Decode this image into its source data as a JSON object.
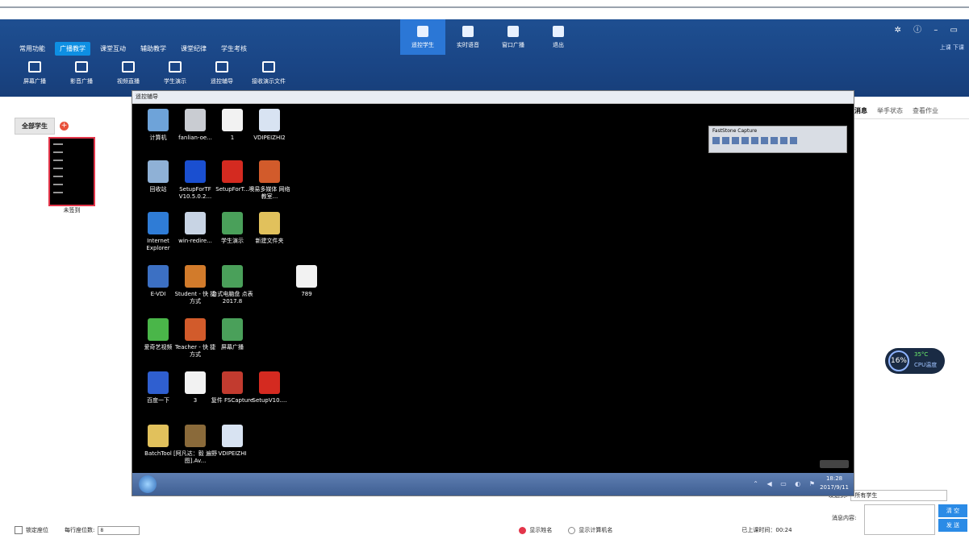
{
  "app": {
    "menu": [
      "常用功能",
      "广播教学",
      "课堂互动",
      "辅助教学",
      "课堂纪律",
      "学生考核"
    ],
    "active_menu": 1,
    "tools": [
      {
        "icon": "screen-broadcast-icon",
        "label": "屏幕广播"
      },
      {
        "icon": "video-broadcast-icon",
        "label": "影音广播"
      },
      {
        "icon": "video-live-icon",
        "label": "视频直播"
      },
      {
        "icon": "student-demo-icon",
        "label": "学生演示"
      },
      {
        "icon": "remote-control-icon",
        "label": "遥控辅导"
      },
      {
        "icon": "file-send-icon",
        "label": "接收演示文件"
      }
    ],
    "top_buttons": [
      {
        "label": "遥控学生",
        "icon": "remote-student-icon",
        "active": true
      },
      {
        "label": "实时语音",
        "icon": "microphone-icon",
        "active": false
      },
      {
        "label": "窗口广播",
        "icon": "window-broadcast-icon",
        "active": false
      },
      {
        "label": "退出",
        "icon": "exit-icon",
        "active": false
      }
    ],
    "window_controls": "✲ ⓘ – ▭",
    "login_links": "上课  下课"
  },
  "left": {
    "tab": "全部学生",
    "student_status": "未签到"
  },
  "right": {
    "tabs": [
      "消息",
      "举手状态",
      "查看作业"
    ],
    "cpu_percent": "16%",
    "cpu_temp": "35°C",
    "cpu_label": "CPU温度",
    "send_to_label": "发送到:",
    "send_to_value": "所有学生",
    "message_label": "消息内容:",
    "clear_btn": "清 空",
    "send_btn": "发 送"
  },
  "status": {
    "lock_seat": "锁定座位",
    "per_row_label": "每行座位数:",
    "per_row_value": "8",
    "show_name": "显示姓名",
    "show_pc": "显示计算机名",
    "elapsed_label": "已上课时间：",
    "elapsed_value": "00:24"
  },
  "remote": {
    "title": "遥控辅导",
    "icons": [
      {
        "label": "计算机",
        "col": 0,
        "row": 0,
        "color": "#6ea3d9"
      },
      {
        "label": "fanlian-oe...",
        "col": 1,
        "row": 0,
        "color": "#c9ccd2"
      },
      {
        "label": "1",
        "col": 2,
        "row": 0,
        "color": "#f2f2f2"
      },
      {
        "label": "VDIPEIZHI2",
        "col": 3,
        "row": 0,
        "color": "#d8e3f2"
      },
      {
        "label": "回收站",
        "col": 0,
        "row": 1,
        "color": "#8fb1d6"
      },
      {
        "label": "SetupForTF V10.5.0.2...",
        "col": 1,
        "row": 1,
        "color": "#1a4fd0"
      },
      {
        "label": "SetupForT...",
        "col": 2,
        "row": 1,
        "color": "#d42a20"
      },
      {
        "label": "噢易多媒体 网络教室...",
        "col": 3,
        "row": 1,
        "color": "#d25b2b"
      },
      {
        "label": "Internet Explorer",
        "col": 0,
        "row": 2,
        "color": "#2f7cd6"
      },
      {
        "label": "win-redire...",
        "col": 1,
        "row": 2,
        "color": "#c8d4e4"
      },
      {
        "label": "学生演示",
        "col": 2,
        "row": 2,
        "color": "#4aa05a"
      },
      {
        "label": "新建文件夹",
        "col": 3,
        "row": 2,
        "color": "#e1c15c"
      },
      {
        "label": "E-VDI",
        "col": 0,
        "row": 3,
        "color": "#3c70c3"
      },
      {
        "label": "Student - 快 捷方式",
        "col": 1,
        "row": 3,
        "color": "#d27b2b"
      },
      {
        "label": "台式电脑盘 点表2017.8",
        "col": 2,
        "row": 3,
        "color": "#4aa05a"
      },
      {
        "label": "789",
        "col": 4,
        "row": 3,
        "color": "#f2f2f2"
      },
      {
        "label": "爱奇艺视频",
        "col": 0,
        "row": 4,
        "color": "#4ab649"
      },
      {
        "label": "Teacher - 快 捷方式",
        "col": 1,
        "row": 4,
        "color": "#d25b2b"
      },
      {
        "label": "屏幕广播",
        "col": 2,
        "row": 4,
        "color": "#4aa05a"
      },
      {
        "label": "百度一下",
        "col": 0,
        "row": 5,
        "color": "#2f5fd0"
      },
      {
        "label": "3",
        "col": 1,
        "row": 5,
        "color": "#f2f2f2"
      },
      {
        "label": "复件 FSCapture",
        "col": 2,
        "row": 5,
        "color": "#c23b2f"
      },
      {
        "label": "SetupV10....",
        "col": 3,
        "row": 5,
        "color": "#d42a20"
      },
      {
        "label": "BatchTool",
        "col": 0,
        "row": 6,
        "color": "#e1c15c"
      },
      {
        "label": "[阿凡达：毅 遍野图].Av...",
        "col": 1,
        "row": 6,
        "color": "#8a6a3a"
      },
      {
        "label": "VDIPEIZHI",
        "col": 2,
        "row": 6,
        "color": "#d8e3f2"
      }
    ],
    "fastone_title": "FastStone Capture",
    "clock_time": "18:28",
    "clock_date": "2017/9/11"
  }
}
